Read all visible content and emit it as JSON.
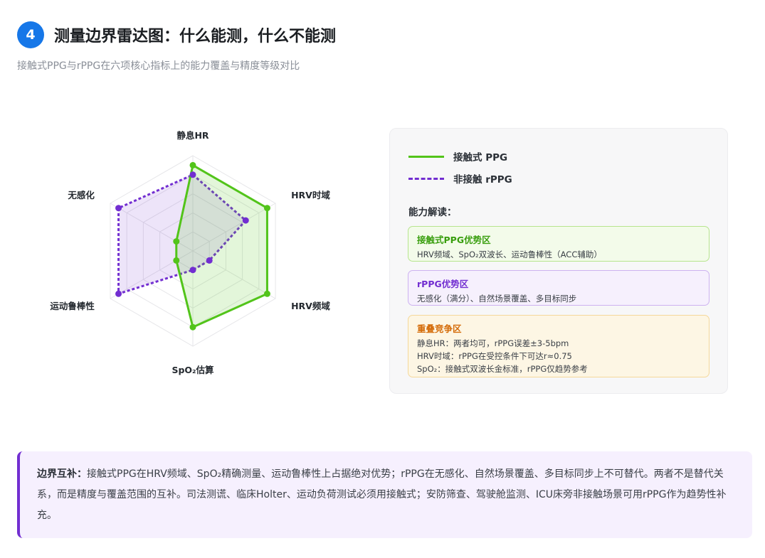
{
  "header": {
    "step": "4",
    "title": "测量边界雷达图：什么能测，什么不能测"
  },
  "subtitle": "接触式PPG与rPPG在六项核心指标上的能力覆盖与精度等级对比",
  "chart_data": {
    "type": "radar",
    "axes": [
      "静息HR",
      "HRV时域",
      "HRV频域",
      "SpO₂估算",
      "运动鲁棒性",
      "无感化"
    ],
    "scale": [
      0,
      5
    ],
    "grid": true,
    "series": [
      {
        "name": "接触式 PPG",
        "color": "#52c41a",
        "fill": "rgba(82,196,26,0.16)",
        "dash": false,
        "values": [
          4.5,
          4.5,
          4.5,
          4.0,
          1.0,
          1.0
        ]
      },
      {
        "name": "非接触 rPPG",
        "color": "#722ed1",
        "fill": "rgba(114,46,209,0.13)",
        "dash": true,
        "values": [
          4.0,
          3.2,
          1.0,
          1.0,
          4.5,
          4.5
        ]
      }
    ]
  },
  "legend": {
    "contact": "接触式 PPG",
    "noncontact": "非接触 rPPG"
  },
  "interpretation": {
    "title": "能力解读：",
    "zones": [
      {
        "title": "接触式PPG优势区",
        "lines": [
          "HRV频域、SpO₂双波长、运动鲁棒性（ACC辅助）"
        ]
      },
      {
        "title": "rPPG优势区",
        "lines": [
          "无感化（满分）、自然场景覆盖、多目标同步"
        ]
      },
      {
        "title": "重叠竞争区",
        "lines": [
          "静息HR：两者均可，rPPG误差±3-5bpm",
          "HRV时域：rPPG在受控条件下可达r≈0.75",
          "SpO₂：接触式双波长金标准，rPPG仅趋势参考"
        ]
      }
    ]
  },
  "note": {
    "label": "边界互补：",
    "text": "接触式PPG在HRV频域、SpO₂精确测量、运动鲁棒性上占据绝对优势；rPPG在无感化、自然场景覆盖、多目标同步上不可替代。两者不是替代关系，而是精度与覆盖范围的互补。司法测谎、临床Holter、运动负荷测试必须用接触式；安防筛查、驾驶舱监测、ICU床旁非接触场景可用rPPG作为趋势性补充。"
  }
}
